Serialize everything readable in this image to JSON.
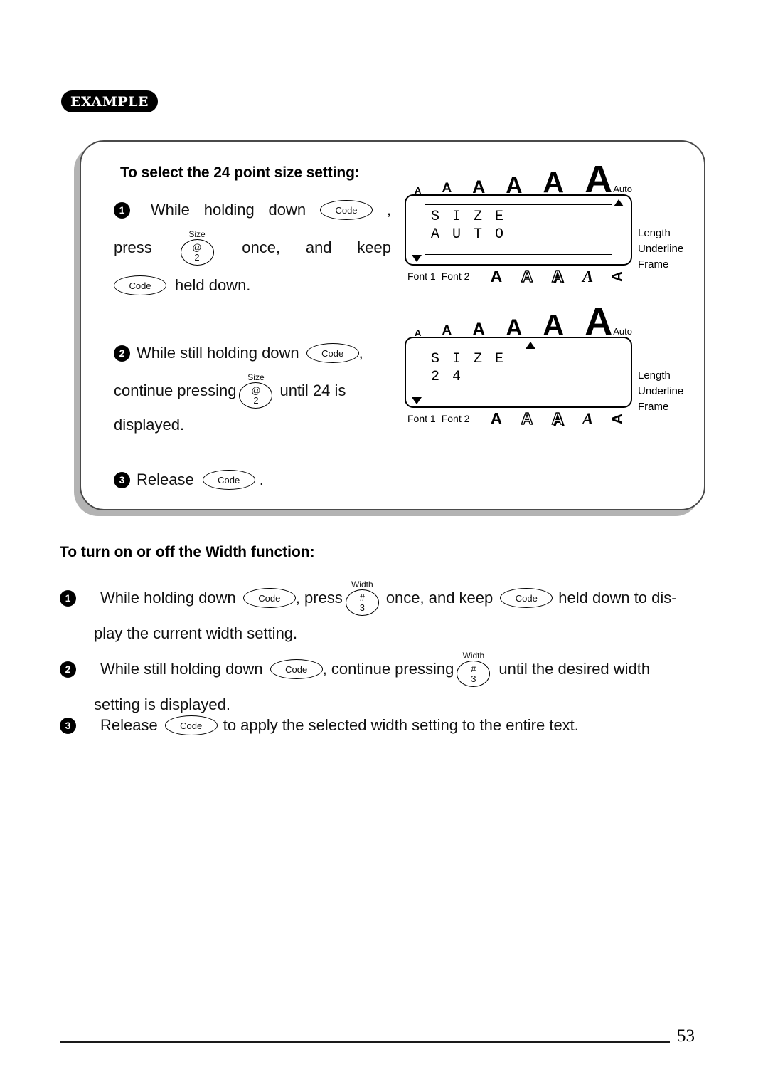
{
  "badge": {
    "label": "EXAMPLE"
  },
  "example": {
    "title": "To select the 24 point size setting:",
    "steps": [
      {
        "num": "1",
        "line1_a": "While",
        "line1_b": "holding",
        "line1_c": "down",
        "key1": "Code",
        "line1_tail": ",",
        "line2_a": "press",
        "key2_label": "Size",
        "key2_top": "@",
        "key2_bottom": "2",
        "line2_b": "once,",
        "line2_c": "and",
        "line2_d": "keep",
        "key3": "Code",
        "line3_a": "held down."
      },
      {
        "num": "2",
        "line1_a": "While still holding down",
        "key1": "Code",
        "line1_tail": ",",
        "line2_a": "continue pressing",
        "key2_label": "Size",
        "key2_top": "@",
        "key2_bottom": "2",
        "line2_b": "until 24 is",
        "line3_a": "displayed."
      },
      {
        "num": "3",
        "line1_a": "Release",
        "key1": "Code",
        "line1_tail": "."
      }
    ]
  },
  "lcd": [
    {
      "name": "size-auto-display",
      "size_scale": [
        "A",
        "A",
        "A",
        "A",
        "A",
        "A"
      ],
      "auto_label": "Auto",
      "marker_position": "auto",
      "screen_line1": "S I Z E",
      "screen_line2": "A U T O",
      "side_labels": [
        "Length",
        "Underline",
        "Frame"
      ],
      "font_labels": [
        "Font 1",
        "Font 2"
      ],
      "style_glyphs": [
        "A",
        "A",
        "A",
        "A",
        "A"
      ]
    },
    {
      "name": "size-24-display",
      "size_scale": [
        "A",
        "A",
        "A",
        "A",
        "A",
        "A"
      ],
      "auto_label": "Auto",
      "marker_position": "fifth",
      "screen_line1": "S I Z E",
      "screen_line2": "2 4",
      "side_labels": [
        "Length",
        "Underline",
        "Frame"
      ],
      "font_labels": [
        "Font 1",
        "Font 2"
      ],
      "style_glyphs": [
        "A",
        "A",
        "A",
        "A",
        "A"
      ]
    }
  ],
  "width_section": {
    "title": "To turn on or off the Width function:",
    "steps": [
      {
        "num": "1",
        "a": "While holding down",
        "key1": "Code",
        "b": ", press",
        "key2_label": "Width",
        "key2_top": "#",
        "key2_bottom": "3",
        "c": "once, and keep",
        "key3": "Code",
        "d": "held down to dis-",
        "line2": "play the current width setting."
      },
      {
        "num": "2",
        "a": "While still holding down",
        "key1": "Code",
        "b": ", continue pressing",
        "key2_label": "Width",
        "key2_top": "#",
        "key2_bottom": "3",
        "c": "until the desired width",
        "line2": "setting is displayed."
      },
      {
        "num": "3",
        "a": "Release",
        "key1": "Code",
        "b": "to apply the selected width setting to the entire text."
      }
    ]
  },
  "footer": {
    "page_number": "53"
  }
}
